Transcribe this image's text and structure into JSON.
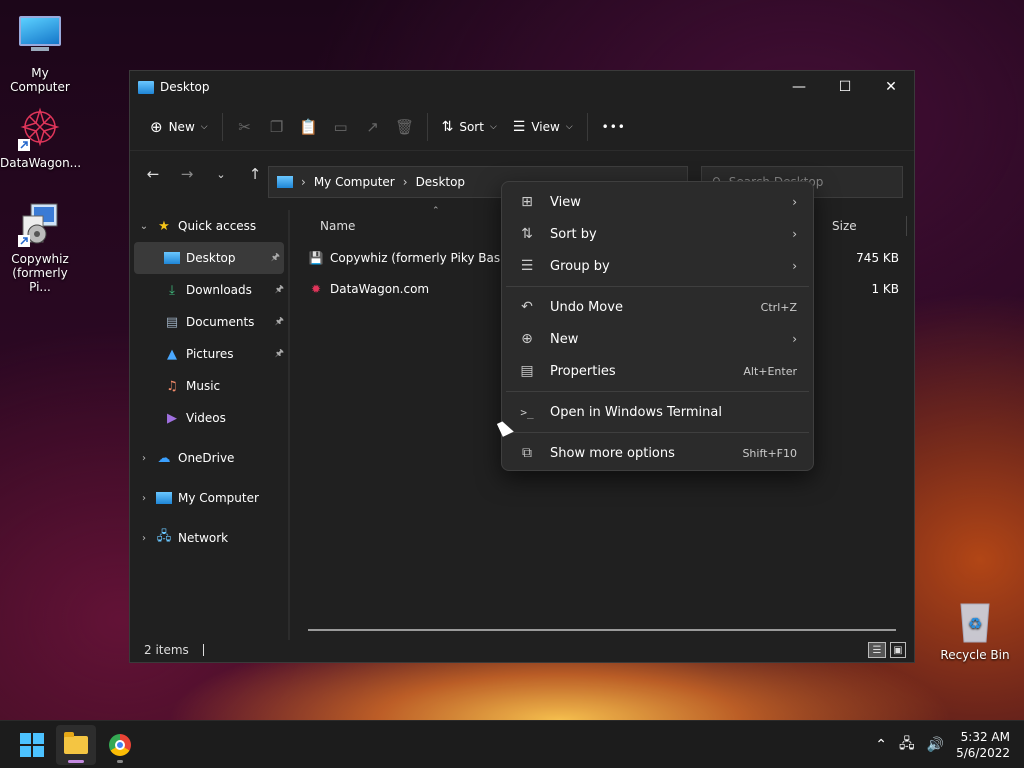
{
  "desktop": {
    "icons": [
      {
        "label": "My Computer"
      },
      {
        "label": "DataWagon..."
      },
      {
        "label": "Copywhiz (formerly Pi..."
      },
      {
        "label": "Recycle Bin"
      }
    ]
  },
  "window": {
    "title": "Desktop",
    "toolbar": {
      "new_label": "New",
      "sort_label": "Sort",
      "view_label": "View",
      "more_label": "•••"
    },
    "address": {
      "segments": [
        "My Computer",
        "Desktop"
      ]
    },
    "search": {
      "placeholder": "Search Desktop"
    },
    "nav": {
      "quick_access": "Quick access",
      "items": [
        {
          "label": "Desktop",
          "icon": "desktop-folder-icon",
          "pinned": true
        },
        {
          "label": "Downloads",
          "icon": "download-icon",
          "pinned": true
        },
        {
          "label": "Documents",
          "icon": "document-icon",
          "pinned": true
        },
        {
          "label": "Pictures",
          "icon": "picture-icon",
          "pinned": true
        },
        {
          "label": "Music",
          "icon": "music-icon",
          "pinned": false
        },
        {
          "label": "Videos",
          "icon": "video-icon",
          "pinned": false
        }
      ],
      "onedrive": "OneDrive",
      "my_computer": "My Computer",
      "network": "Network"
    },
    "columns": {
      "name": "Name",
      "size": "Size"
    },
    "files": [
      {
        "name": "Copywhiz (formerly Piky Basket)",
        "size": "745 KB"
      },
      {
        "name": "DataWagon.com",
        "size": "1 KB"
      }
    ],
    "status": {
      "item_count": "2 items"
    }
  },
  "context_menu": {
    "items": [
      {
        "label": "View",
        "shortcut": "",
        "submenu": true
      },
      {
        "label": "Sort by",
        "shortcut": "",
        "submenu": true
      },
      {
        "label": "Group by",
        "shortcut": "",
        "submenu": true
      },
      {
        "label": "Undo Move",
        "shortcut": "Ctrl+Z",
        "submenu": false
      },
      {
        "label": "New",
        "shortcut": "",
        "submenu": true
      },
      {
        "label": "Properties",
        "shortcut": "Alt+Enter",
        "submenu": false
      },
      {
        "label": "Open in Windows Terminal",
        "shortcut": "",
        "submenu": false
      },
      {
        "label": "Show more options",
        "shortcut": "Shift+F10",
        "submenu": false
      }
    ]
  },
  "taskbar": {
    "time": "5:32 AM",
    "date": "5/6/2022"
  },
  "colors": {
    "accent": "#4cc2ff",
    "window_bg": "#202020",
    "menu_bg": "#2b2b2b"
  }
}
